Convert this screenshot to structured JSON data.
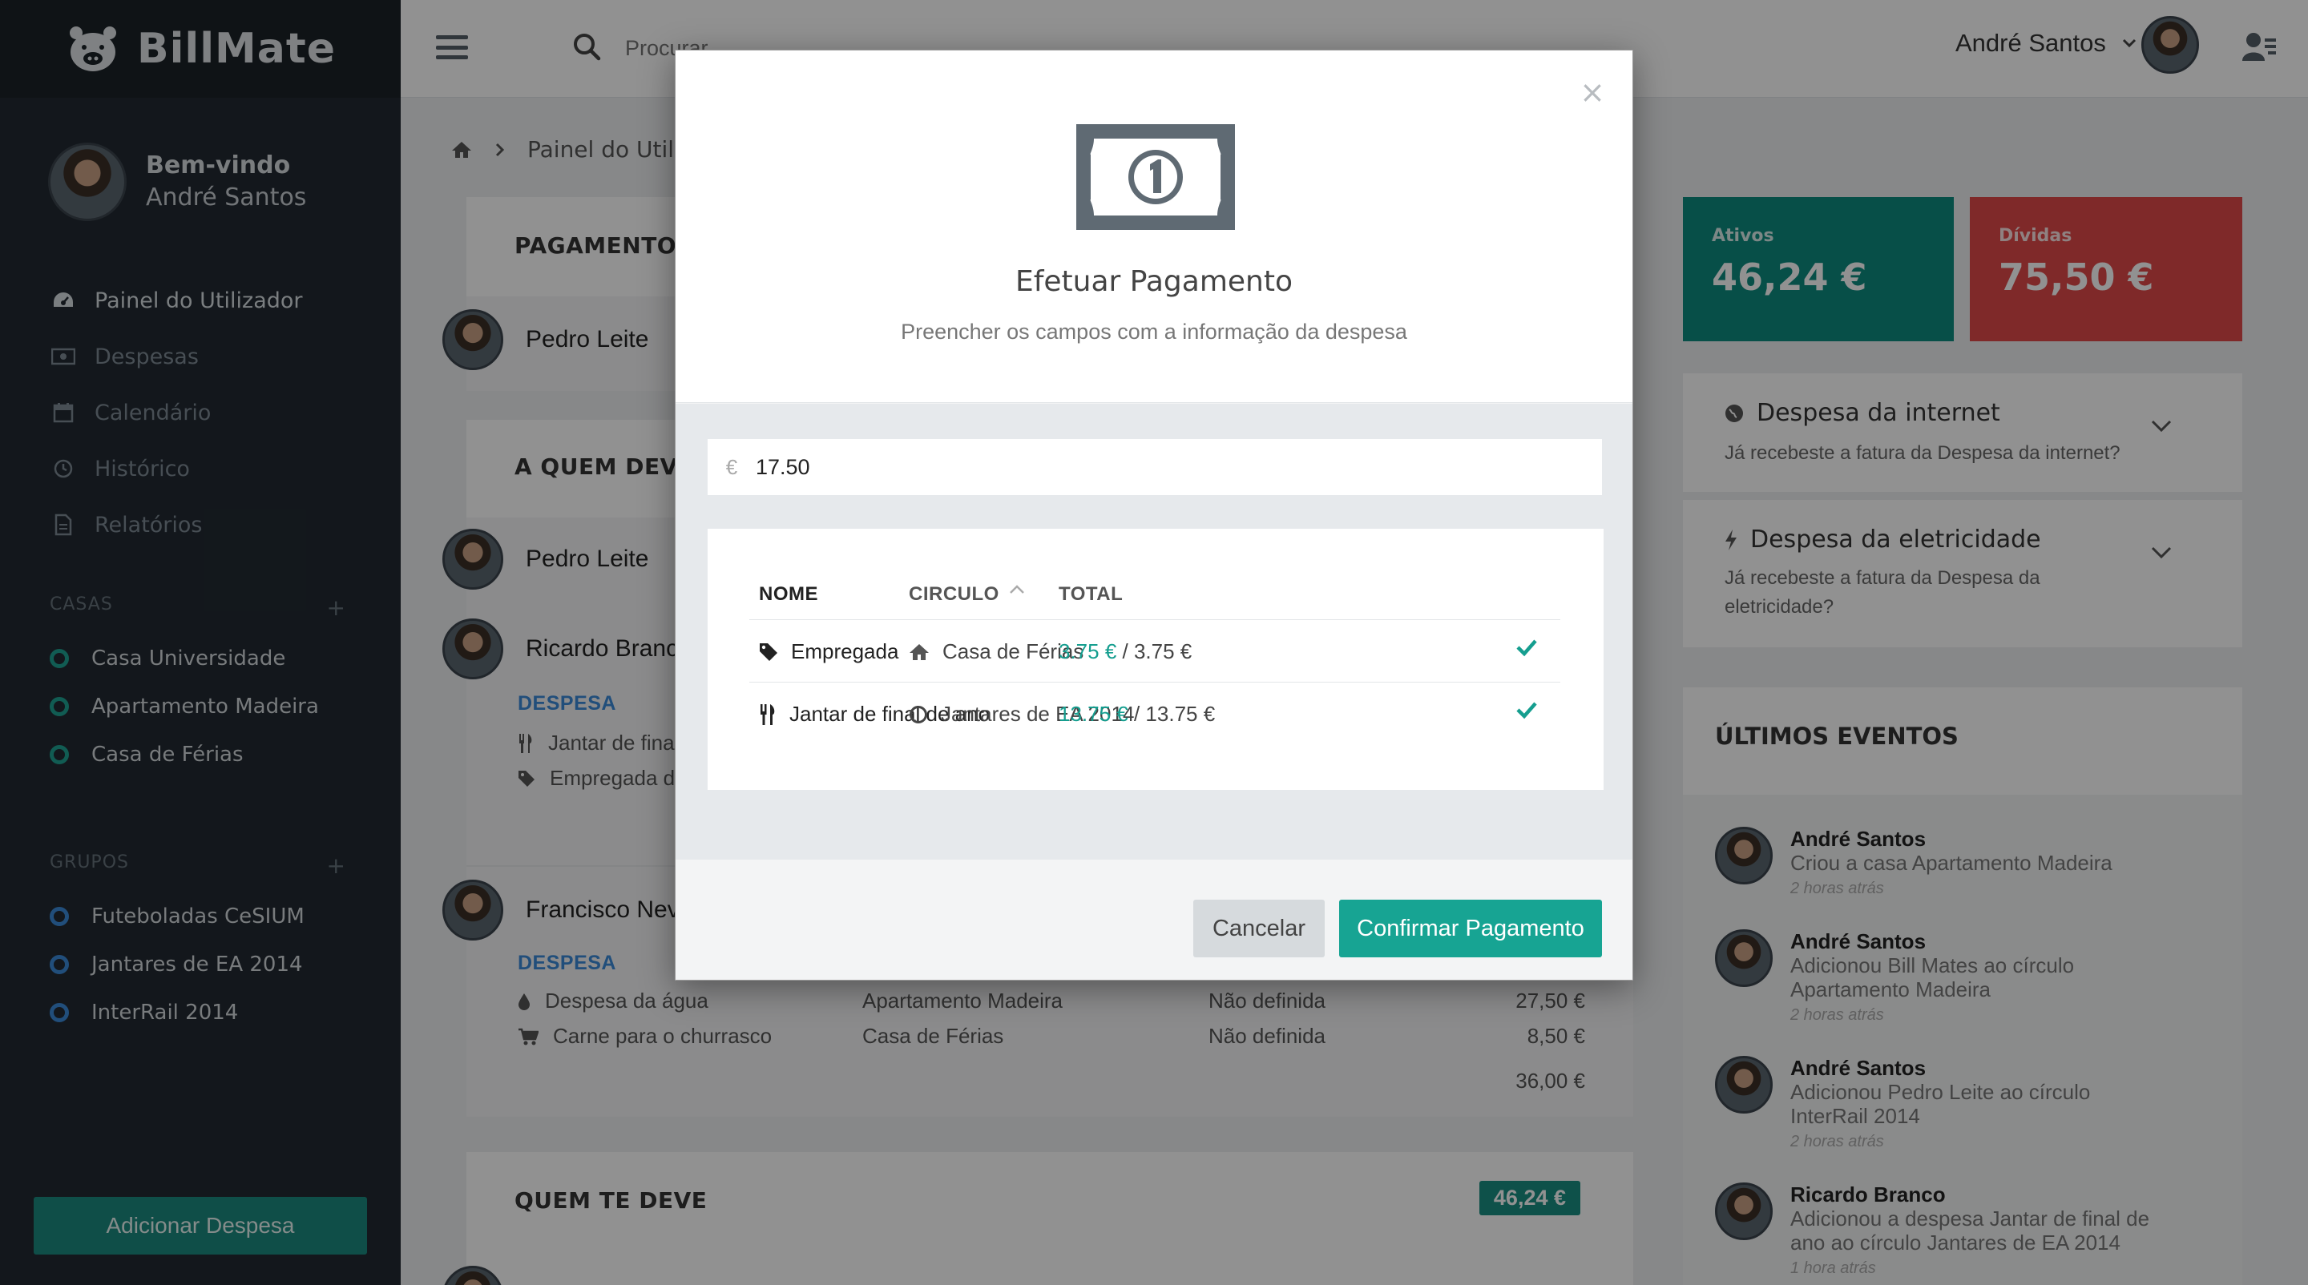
{
  "app": {
    "name": "BillMate"
  },
  "topbar": {
    "search_placeholder": "Procurar",
    "user_name": "André Santos"
  },
  "sidebar": {
    "welcome": "Bem-vindo",
    "user_name": "André Santos",
    "nav": [
      {
        "label": "Painel do Utilizador",
        "icon": "dashboard-icon",
        "active": true
      },
      {
        "label": "Despesas",
        "icon": "money-icon"
      },
      {
        "label": "Calendário",
        "icon": "calendar-icon"
      },
      {
        "label": "Histórico",
        "icon": "clock-icon"
      },
      {
        "label": "Relatórios",
        "icon": "file-icon"
      }
    ],
    "casas_label": "CASAS",
    "casas": [
      "Casa Universidade",
      "Apartamento Madeira",
      "Casa de Férias"
    ],
    "grupos_label": "GRUPOS",
    "grupos": [
      "Futeboladas CeSIUM",
      "Jantares de EA 2014",
      "InterRail 2014"
    ],
    "add_button": "Adicionar Despesa"
  },
  "breadcrumb": {
    "current": "Painel do Utilizador"
  },
  "main": {
    "pagamentos": {
      "title": "PAGAMENTOS",
      "person": "Pedro Leite"
    },
    "a_quem_deves": {
      "title": "A QUEM DEVES",
      "people": [
        "Pedro Leite",
        "Ricardo Branco",
        "Francisco Neves"
      ],
      "despesa_label": "DESPESA",
      "ricardo_items": [
        "Jantar de final de ano",
        "Empregada doméstica"
      ],
      "francisco_items": [
        {
          "name": "Despesa da água",
          "circle": "Apartamento Madeira",
          "date": "Não definida",
          "value": "27,50 €"
        },
        {
          "name": "Carne para o churrasco",
          "circle": "Casa de Férias",
          "date": "Não definida",
          "value": "8,50 €"
        }
      ],
      "francisco_total": "36,00 €"
    },
    "quem_te_deve": {
      "title": "QUEM TE DEVE",
      "badge": "46,24 €"
    }
  },
  "right": {
    "ativos": {
      "label": "Ativos",
      "value": "46,24 €",
      "color": "#0d8c7f"
    },
    "dividas": {
      "label": "Dívidas",
      "value": "75,50 €",
      "color": "#e04848"
    },
    "notes": [
      {
        "title": "Despesa da internet",
        "sub": "Já recebeste a fatura da Despesa da internet?",
        "icon": "globe-icon"
      },
      {
        "title": "Despesa da eletricidade",
        "sub": "Já recebeste a fatura da Despesa da eletricidade?",
        "icon": "bolt-icon"
      }
    ],
    "events_title": "ÚLTIMOS EVENTOS",
    "events": [
      {
        "name": "André Santos",
        "desc": "Criou a casa Apartamento Madeira",
        "time": "2 horas atrás"
      },
      {
        "name": "André Santos",
        "desc": "Adicionou Bill Mates ao círculo Apartamento Madeira",
        "time": "2 horas atrás"
      },
      {
        "name": "André Santos",
        "desc": "Adicionou Pedro Leite ao círculo InterRail 2014",
        "time": "2 horas atrás"
      },
      {
        "name": "Ricardo Branco",
        "desc": "Adicionou a despesa Jantar de final de ano ao círculo Jantares de EA 2014",
        "time": "1 hora atrás"
      }
    ]
  },
  "modal": {
    "title": "Efetuar Pagamento",
    "subtitle": "Preencher os campos com a informação da despesa",
    "currency": "€",
    "amount": "17.50",
    "columns": {
      "name": "NOME",
      "circle": "CIRCULO",
      "total": "TOTAL"
    },
    "rows": [
      {
        "name": "Empregada",
        "name_icon": "tag-icon",
        "circle": "Casa de Férias",
        "circle_icon": "home-icon",
        "paid": "3.75 €",
        "total": " / 3.75 €"
      },
      {
        "name": "Jantar de final de ano",
        "name_icon": "cutlery-icon",
        "circle": "Jantares de EA 2014",
        "circle_icon": "circle-icon",
        "paid": "13.75 €",
        "total": " / 13.75 €"
      }
    ],
    "cancel": "Cancelar",
    "confirm": "Confirmar Pagamento"
  }
}
